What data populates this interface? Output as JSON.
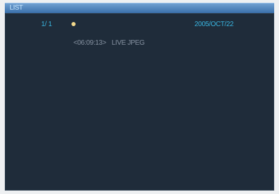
{
  "window": {
    "title": "LIST"
  },
  "list": {
    "page_counter": "1/ 1",
    "date": "2005/OCT/22",
    "marker_icon": "record-dot-icon",
    "entries": [
      {
        "time": "<06:09:13>",
        "type": "LIVE JPEG"
      }
    ]
  },
  "colors": {
    "title_bar": "#3a70ab",
    "panel_bg": "#1f2c3a",
    "accent_text": "#39b4df",
    "entry_text": "#8793a2",
    "marker": "#f3d98c"
  }
}
